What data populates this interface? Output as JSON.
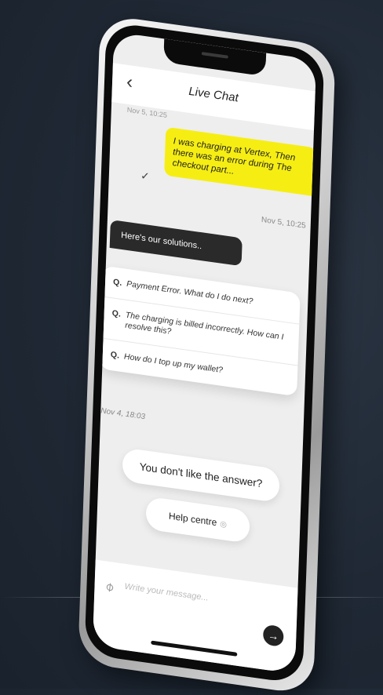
{
  "header": {
    "back_icon": "chevron-left-icon",
    "title": "Live Chat"
  },
  "chat": {
    "top_date": "Nov 5, 10:25",
    "user_message": "I was charging at Vertex, Then there was an error during The checkout part...",
    "user_timestamp": "Nov 5, 10:25",
    "bot_message": "Here's our solutions..",
    "faq": [
      {
        "q": "Q.",
        "text": "Payment Error. What do I do next?"
      },
      {
        "q": "Q.",
        "text": "The charging is billed incorrectly. How can I resolve this?"
      },
      {
        "q": "Q.",
        "text": "How do I top up my wallet?"
      }
    ],
    "bot_timestamp": "Nov 4, 18:03"
  },
  "actions": {
    "dislike_label": "You don't like the answer?",
    "help_label": "Help centre"
  },
  "composer": {
    "placeholder": "Write your message...",
    "attach_icon": "paperclip-icon",
    "send_icon": "arrow-right-icon"
  },
  "colors": {
    "accent": "#f6ee13",
    "bot_bubble": "#2a2a2a",
    "background": "#1f2834"
  }
}
